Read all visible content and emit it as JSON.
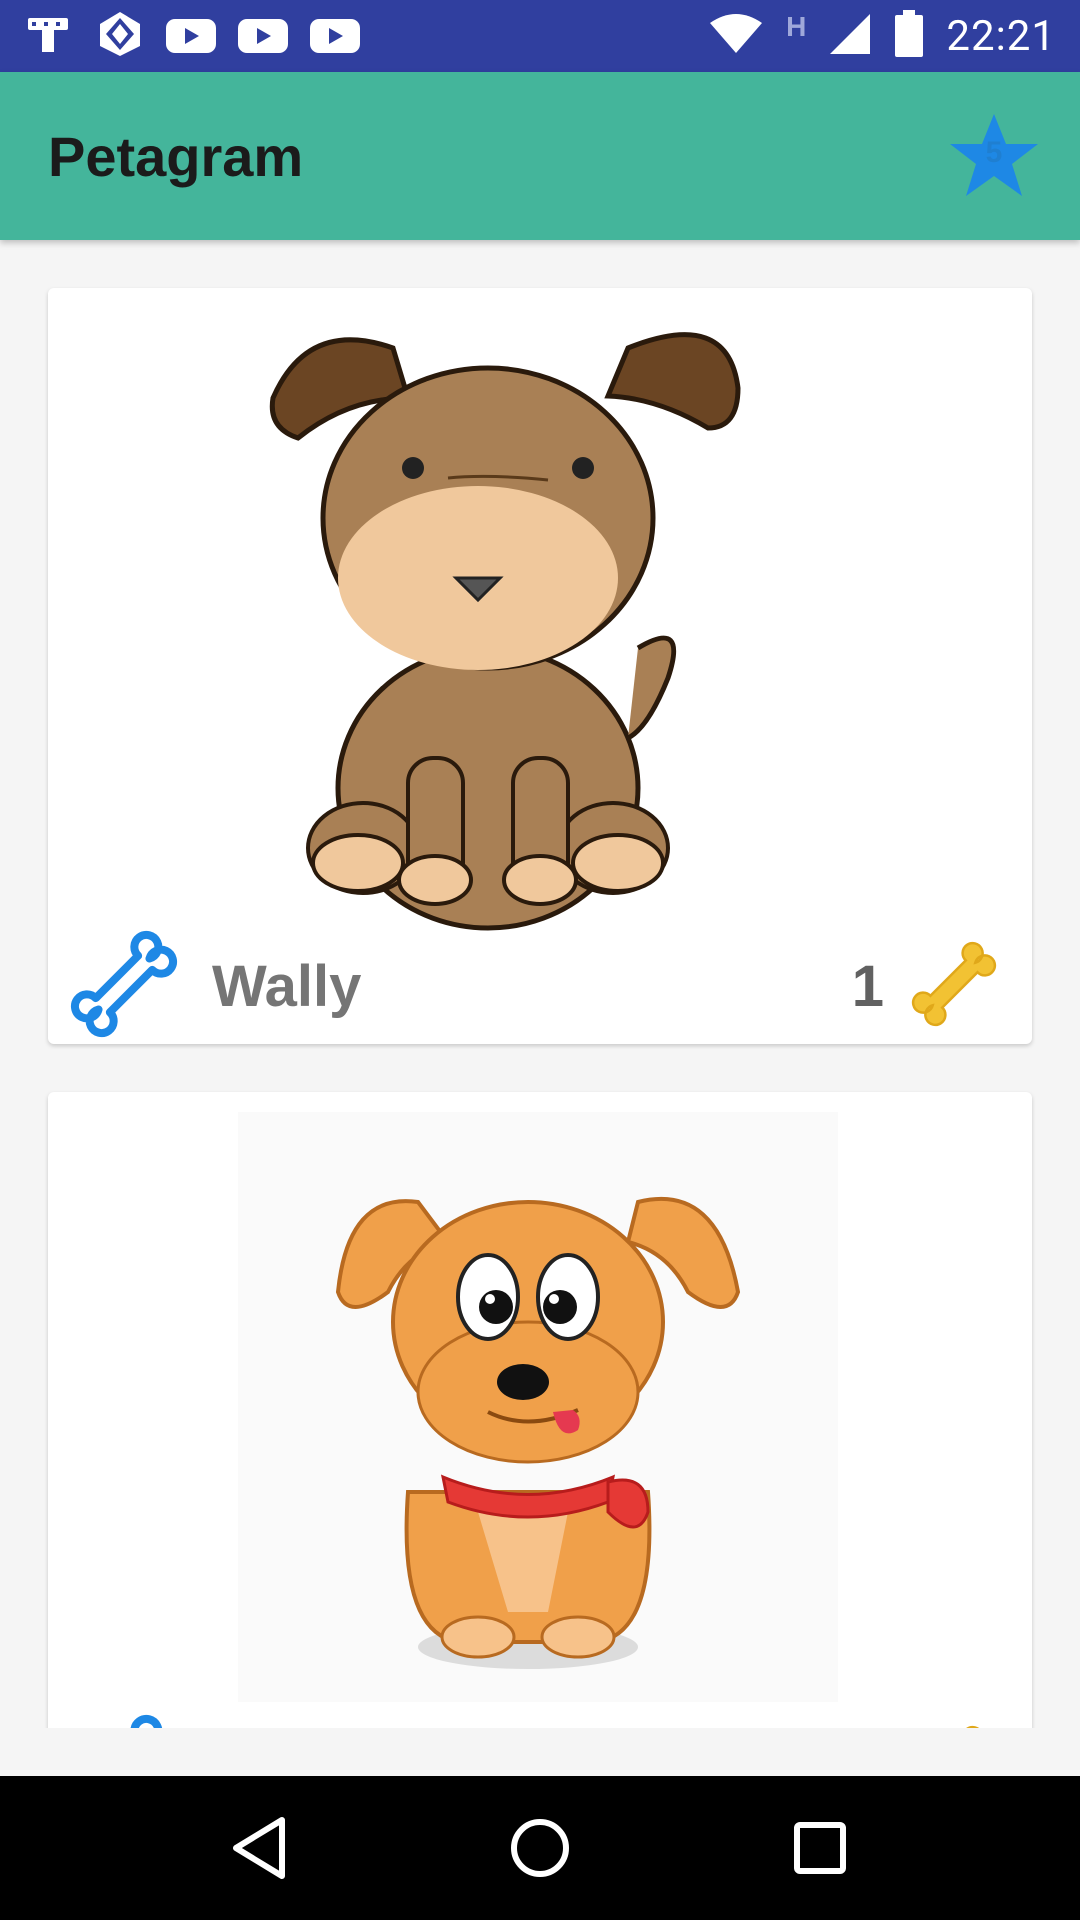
{
  "status_bar": {
    "time": "22:21",
    "network": "H",
    "icons": [
      "launcher-icon",
      "app-icon",
      "youtube-icon",
      "youtube-icon",
      "youtube-icon",
      "wifi-icon",
      "signal-icon",
      "battery-icon"
    ]
  },
  "app_bar": {
    "title": "Petagram",
    "favorites_count": "5"
  },
  "pets": [
    {
      "name": "Wally",
      "rating": "1"
    },
    {
      "name": "",
      "rating": ""
    }
  ],
  "colors": {
    "status_bar": "#303f9f",
    "app_bar": "#44b59b",
    "bone_outline": "#1e88e5",
    "bone_gold": "#f2c233"
  },
  "nav": [
    "back-icon",
    "home-icon",
    "recents-icon"
  ]
}
